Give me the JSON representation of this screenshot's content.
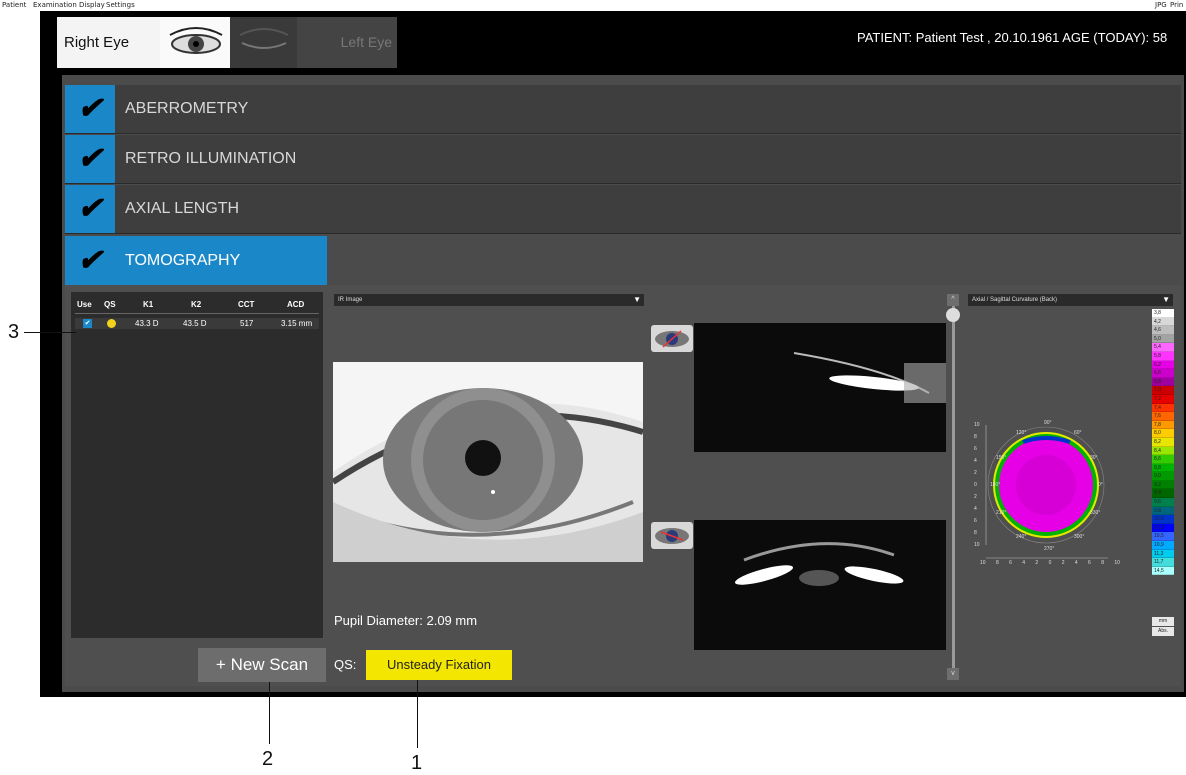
{
  "menu": {
    "items": [
      "Patient",
      "Examination",
      "Display",
      "Settings"
    ],
    "right_items": [
      "JPG",
      "Prin"
    ]
  },
  "eye_selector": {
    "right_label": "Right Eye",
    "left_label": "Left Eye"
  },
  "patient_info": "PATIENT: Patient Test , 20.10.1961   AGE (TODAY): 58",
  "sections": [
    {
      "label": "ABERROMETRY",
      "checked": true
    },
    {
      "label": "RETRO ILLUMINATION",
      "checked": true
    },
    {
      "label": "AXIAL LENGTH",
      "checked": true
    }
  ],
  "check_glyph": "✔",
  "active_tab": {
    "label": "TOMOGRAPHY"
  },
  "scan_table": {
    "headers": [
      "Use",
      "QS",
      "K1",
      "K2",
      "CCT",
      "ACD"
    ],
    "rows": [
      {
        "use": "✔",
        "qs": "",
        "k1": "43.3 D",
        "k2": "43.5 D",
        "cct": "517",
        "acd": "3.15 mm"
      }
    ]
  },
  "new_scan_label": "+ New Scan",
  "qs": {
    "label": "QS:",
    "value": "Unsteady Fixation",
    "color": "#f3e600"
  },
  "ir_dropdown": "IR Image",
  "pupil_diameter": "Pupil Diameter: 2.09 mm",
  "map_dropdown": "Axial / Sagittal Curvature (Back)",
  "slider": {
    "up": "^",
    "down": "v"
  },
  "color_scale": {
    "values": [
      "3,8",
      "4,2",
      "4,6",
      "5,0",
      "5,4",
      "5,8",
      "6,2",
      "6,6",
      "6,8",
      "7,0",
      "7,2",
      "7,4",
      "7,6",
      "7,8",
      "8,0",
      "8,2",
      "8,4",
      "8,6",
      "8,8",
      "9,0",
      "9,2",
      "9,4",
      "9,6",
      "9,8",
      "10,0",
      "10,2",
      "10,5",
      "10,9",
      "11,3",
      "11,7",
      "14,5"
    ],
    "colors": [
      "#ffffff",
      "#d8d8d8",
      "#bdbdbd",
      "#a3a3a3",
      "#ff66ff",
      "#ff33ff",
      "#e600e6",
      "#cc00cc",
      "#a000a0",
      "#cc0000",
      "#e60000",
      "#ff3300",
      "#ff6600",
      "#ff9900",
      "#ffcc00",
      "#e6e600",
      "#99e600",
      "#33cc00",
      "#00b300",
      "#009900",
      "#008000",
      "#006600",
      "#00804d",
      "#006680",
      "#0033cc",
      "#0000ff",
      "#3366ff",
      "#00aaff",
      "#00ccee",
      "#44dddd",
      "#aaffff"
    ],
    "unit": "mm",
    "mode": "Abs."
  },
  "map_axis_ticks": [
    "10",
    "8",
    "6",
    "4",
    "2",
    "0",
    "2",
    "4",
    "6",
    "8",
    "10"
  ],
  "map_angles": [
    "90°",
    "120°",
    "60°",
    "150°",
    "30°",
    "180°",
    "0°",
    "210°",
    "330°",
    "240°",
    "300°",
    "270°"
  ],
  "annotations": [
    "3",
    "2",
    "1"
  ]
}
